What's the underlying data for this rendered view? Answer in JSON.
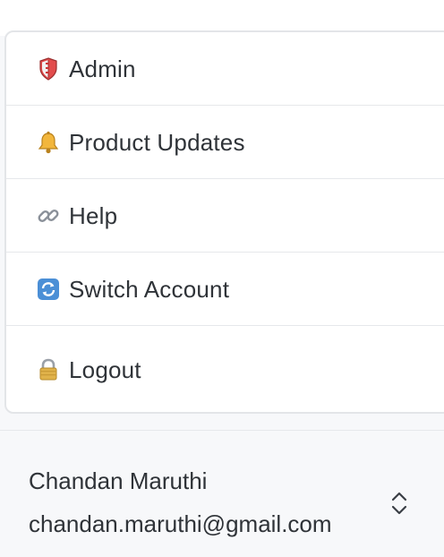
{
  "menu": {
    "items": [
      {
        "label": "Admin",
        "icon": "shield-icon"
      },
      {
        "label": "Product Updates",
        "icon": "bell-icon"
      },
      {
        "label": "Help",
        "icon": "link-icon"
      },
      {
        "label": "Switch Account",
        "icon": "refresh-icon"
      },
      {
        "label": "Logout",
        "icon": "lock-icon"
      }
    ]
  },
  "account": {
    "name": "Chandan Maruthi",
    "email": "chandan.maruthi@gmail.com",
    "toggle_icon": "chevron-up-down-icon"
  }
}
